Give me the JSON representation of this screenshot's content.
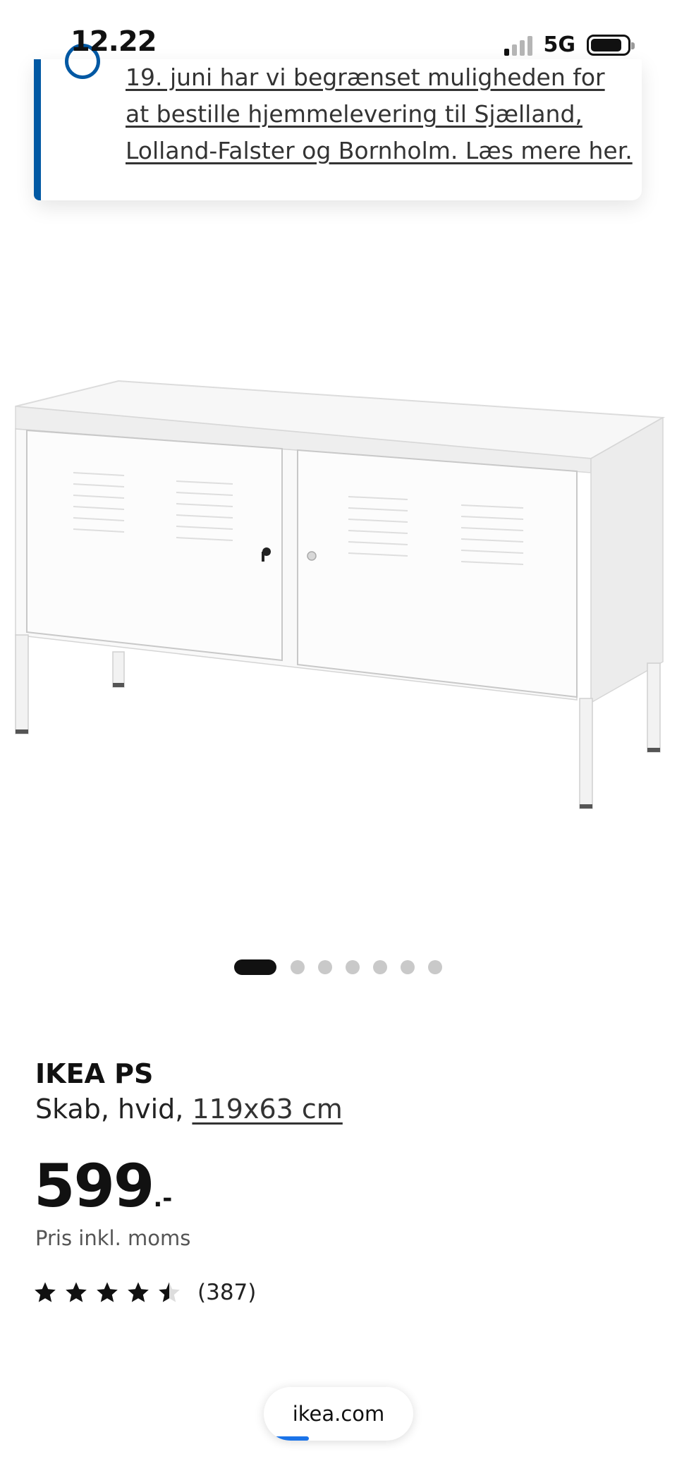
{
  "status_bar": {
    "time": "12.22",
    "network": "5G",
    "signal_bars_active": 1,
    "signal_bars_total": 4,
    "battery_level": 0.85
  },
  "notice": {
    "text": "19. juni har vi begrænset muligheden for at bestille hjemmelevering til Sjælland, Lolland-Falster og Bornholm. Læs mere her.",
    "accent_color": "#0058a3"
  },
  "carousel": {
    "total": 7,
    "active_index": 0
  },
  "product": {
    "brand": "IKEA PS",
    "description_prefix": "Skab, hvid,",
    "size_link": "119x63 cm",
    "price": "599",
    "price_suffix": ".-",
    "vat_note": "Pris inkl. moms",
    "rating": 4.5,
    "rating_max": 5,
    "review_count": "(387)"
  },
  "browser": {
    "url": "ikea.com",
    "load_progress": 0.3
  },
  "icons": {
    "notice": "info-icon",
    "star": "star-icon",
    "battery": "battery-icon",
    "signal": "cellular-signal-icon"
  }
}
